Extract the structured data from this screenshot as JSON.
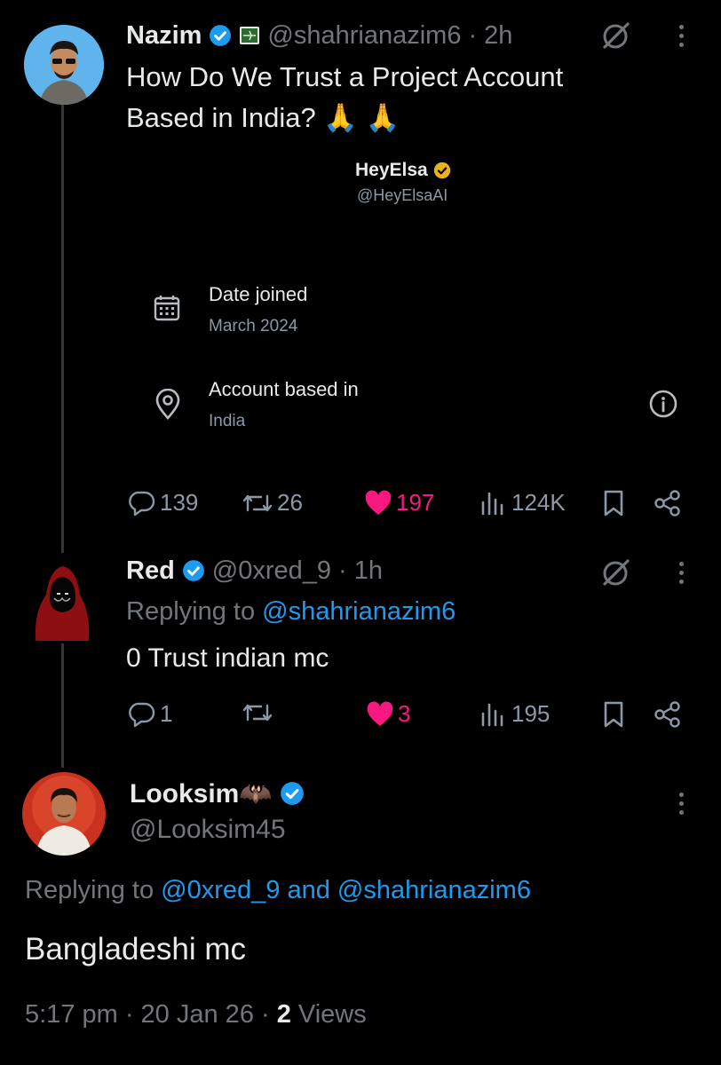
{
  "tweet1": {
    "name": "Nazim",
    "handle": "@shahrianazim6",
    "time": "· 2h",
    "text_line1": "How Do We Trust a Project Account",
    "text_line2": "Based in India? 🙏 🙏",
    "embed": {
      "name": "HeyElsa",
      "handle": "@HeyElsaAI",
      "date_label": "Date joined",
      "date_value": "March 2024",
      "location_label": "Account based in",
      "location_value": "India"
    },
    "actions": {
      "replies": "139",
      "reposts": "26",
      "likes": "197",
      "views": "124K"
    }
  },
  "tweet2": {
    "name": "Red",
    "handle": "@0xred_9",
    "time": "· 1h",
    "replying_prefix": "Replying to",
    "replying_to": "@shahrianazim6",
    "text": "0 Trust indian mc",
    "actions": {
      "replies": "1",
      "reposts": "",
      "likes": "3",
      "views": "195"
    }
  },
  "tweet3": {
    "name": "Looksim🦇",
    "handle": "@Looksim45",
    "replying_prefix": "Replying to",
    "replying_to_a": "@0xred_9",
    "replying_and": "and",
    "replying_to_b": "@shahrianazim6",
    "text": "Bangladeshi mc",
    "timestamp": "5:17 pm · 20 Jan 26 ·",
    "views_count": "2",
    "views_label": "Views"
  },
  "colors": {
    "like": "#f91880",
    "link": "#1d9bf0",
    "verified": "#1d9bf0",
    "gold": "#e8b21a"
  }
}
